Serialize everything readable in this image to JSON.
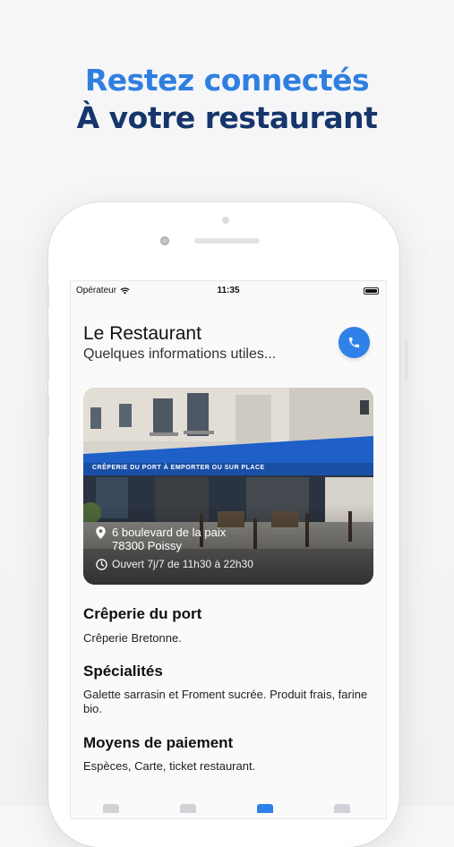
{
  "headline": {
    "line1": "Restez connectés",
    "line2": "À votre restaurant"
  },
  "status_bar": {
    "carrier": "Opérateur",
    "time": "11:35"
  },
  "restaurant": {
    "name": "Le Restaurant",
    "subtitle": "Quelques informations utiles...",
    "address_line1": "6 boulevard de la paix",
    "address_line2": "78300 Poissy",
    "hours": "Ouvert 7j/7 de 11h30 à 22h30",
    "awning_text": "CRÊPERIE DU PORT  À EMPORTER OU SUR PLACE"
  },
  "sections": [
    {
      "title": "Crêperie du port",
      "text": "Crêperie Bretonne."
    },
    {
      "title": "Spécialités",
      "text": "Galette sarrasin et Froment sucrée. Produit frais, farine bio."
    },
    {
      "title": "Moyens de paiement",
      "text": "Espèces, Carte, ticket restaurant."
    }
  ],
  "icons": {
    "call": "phone-icon",
    "location": "map-pin-icon",
    "clock": "clock-icon",
    "wifi": "wifi-icon",
    "battery": "battery-icon"
  },
  "colors": {
    "accent": "#2f80e8",
    "headline_light": "#2f7fe0",
    "headline_dark": "#16356b",
    "awning": "#1e5fc8"
  }
}
